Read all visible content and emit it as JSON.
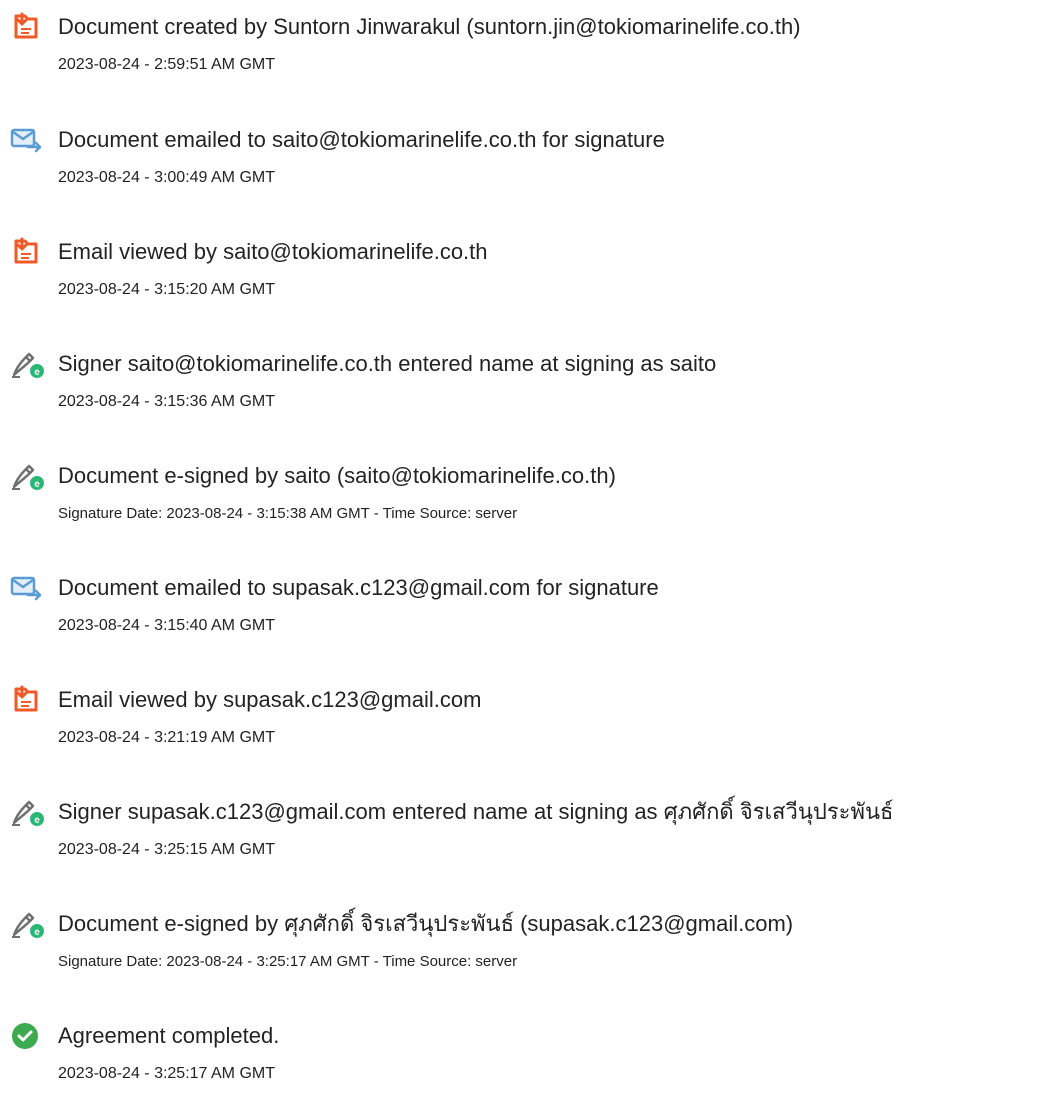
{
  "events": [
    {
      "icon": "document-created-icon",
      "title": "Document created by Suntorn Jinwarakul (suntorn.jin@tokiomarinelife.co.th)",
      "time": "2023-08-24 - 2:59:51 AM GMT"
    },
    {
      "icon": "email-sent-icon",
      "title": "Document emailed to saito@tokiomarinelife.co.th for signature",
      "time": "2023-08-24 - 3:00:49 AM GMT"
    },
    {
      "icon": "document-viewed-icon",
      "title": "Email viewed by saito@tokiomarinelife.co.th",
      "time": "2023-08-24 - 3:15:20 AM GMT"
    },
    {
      "icon": "pen-sign-icon",
      "title": "Signer saito@tokiomarinelife.co.th entered name at signing as saito",
      "time": "2023-08-24 - 3:15:36 AM GMT"
    },
    {
      "icon": "pen-sign-icon",
      "title": "Document e-signed by saito (saito@tokiomarinelife.co.th)",
      "time": "Signature Date: 2023-08-24 - 3:15:38 AM GMT - Time Source: server"
    },
    {
      "icon": "email-sent-icon",
      "title": "Document emailed to supasak.c123@gmail.com for signature",
      "time": "2023-08-24 - 3:15:40 AM GMT"
    },
    {
      "icon": "document-viewed-icon",
      "title": "Email viewed by supasak.c123@gmail.com",
      "time": "2023-08-24 - 3:21:19 AM GMT"
    },
    {
      "icon": "pen-sign-icon",
      "title": "Signer supasak.c123@gmail.com entered name at signing as ศุภศักดิ์ จิรเสวีนุประพันธ์",
      "time": "2023-08-24 - 3:25:15 AM GMT"
    },
    {
      "icon": "pen-sign-icon",
      "title": "Document e-signed by ศุภศักดิ์ จิรเสวีนุประพันธ์ (supasak.c123@gmail.com)",
      "time": "Signature Date: 2023-08-24 - 3:25:17 AM GMT - Time Source: server"
    },
    {
      "icon": "check-circle-icon",
      "title": "Agreement completed.",
      "time": "2023-08-24 - 3:25:17 AM GMT"
    }
  ],
  "colors": {
    "acrobat_orange": "#F05A28",
    "email_blue": "#5A9BD6",
    "pen_gray": "#6F6F6F",
    "sign_green": "#2BB673",
    "complete_green": "#3DAA4F"
  }
}
